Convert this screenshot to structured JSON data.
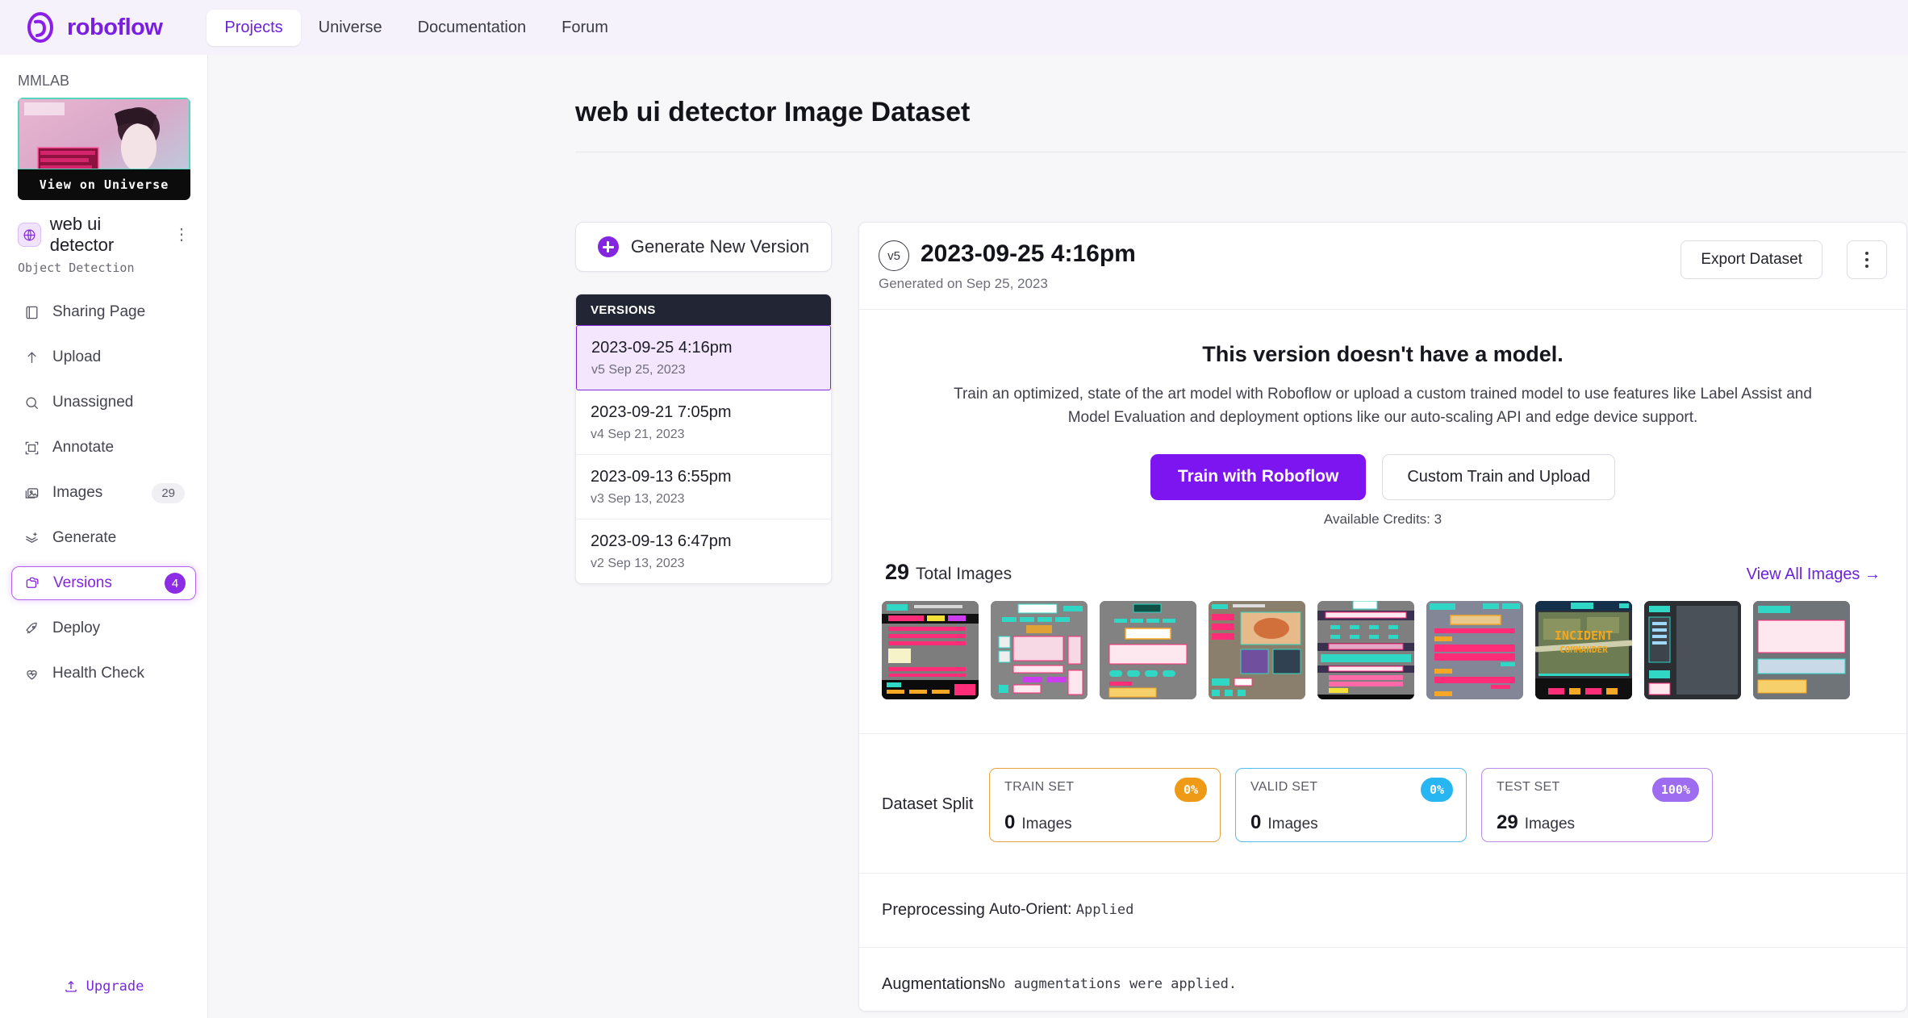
{
  "topnav": {
    "brand": "roboflow",
    "items": [
      {
        "label": "Projects",
        "active": true
      },
      {
        "label": "Universe",
        "active": false
      },
      {
        "label": "Documentation",
        "active": false
      },
      {
        "label": "Forum",
        "active": false
      }
    ]
  },
  "sidebar": {
    "workspace": "MMLAB",
    "thumbnail_overlay": "View on Universe",
    "project_name": "web ui detector",
    "project_type": "Object Detection",
    "items": [
      {
        "label": "Sharing Page",
        "icon": "book-icon",
        "badge": null,
        "selected": false
      },
      {
        "label": "Upload",
        "icon": "upload-arrow-icon",
        "badge": null,
        "selected": false
      },
      {
        "label": "Unassigned",
        "icon": "search-icon",
        "badge": null,
        "selected": false
      },
      {
        "label": "Annotate",
        "icon": "annotate-box-icon",
        "badge": null,
        "selected": false
      },
      {
        "label": "Images",
        "icon": "images-icon",
        "badge": "29",
        "selected": false
      },
      {
        "label": "Generate",
        "icon": "layers-plus-icon",
        "badge": null,
        "selected": false
      },
      {
        "label": "Versions",
        "icon": "folders-icon",
        "badge": "4",
        "selected": true
      },
      {
        "label": "Deploy",
        "icon": "rocket-icon",
        "badge": null,
        "selected": false
      },
      {
        "label": "Health Check",
        "icon": "heart-pulse-icon",
        "badge": null,
        "selected": false
      }
    ],
    "upgrade_label": "Upgrade"
  },
  "page": {
    "title": "web ui detector Image Dataset"
  },
  "left_column": {
    "generate_button": "Generate New Version",
    "versions_header": "VERSIONS",
    "versions": [
      {
        "name": "2023-09-25 4:16pm",
        "sub": "v5 Sep 25, 2023",
        "selected": true
      },
      {
        "name": "2023-09-21 7:05pm",
        "sub": "v4 Sep 21, 2023",
        "selected": false
      },
      {
        "name": "2023-09-13 6:55pm",
        "sub": "v3 Sep 13, 2023",
        "selected": false
      },
      {
        "name": "2023-09-13 6:47pm",
        "sub": "v2 Sep 13, 2023",
        "selected": false
      }
    ]
  },
  "version_card": {
    "version_badge": "v5",
    "title": "2023-09-25 4:16pm",
    "generated_on": "Generated on Sep 25, 2023",
    "export_label": "Export Dataset",
    "model": {
      "heading": "This version doesn't have a model.",
      "description": "Train an optimized, state of the art model with Roboflow or upload a custom trained model to use features like Label Assist and Model Evaluation and deployment options like our auto-scaling API and edge device support.",
      "primary_button": "Train with Roboflow",
      "secondary_button": "Custom Train and Upload",
      "credits": "Available Credits:  3"
    },
    "images": {
      "count": "29",
      "count_label": "Total Images",
      "view_all": "View All Images",
      "thumbnail_count": 9
    },
    "dataset_split": {
      "label": "Dataset Split",
      "cards": [
        {
          "title": "TRAIN SET",
          "pill": "0%",
          "count": "0",
          "unit": "Images",
          "color": "#ef9a16"
        },
        {
          "title": "VALID SET",
          "pill": "0%",
          "count": "0",
          "unit": "Images",
          "color": "#27b6f2"
        },
        {
          "title": "TEST SET",
          "pill": "100%",
          "count": "29",
          "unit": "Images",
          "color": "#9d6cf0"
        }
      ]
    },
    "preprocessing": {
      "label": "Preprocessing",
      "key": "Auto-Orient:",
      "value": "Applied"
    },
    "augmentations": {
      "label": "Augmentations",
      "value": "No augmentations were applied."
    }
  },
  "colors": {
    "brand_purple": "#7a1ee0",
    "primary_button": "#7c15f0",
    "selected_version_bg": "#f4e6fd",
    "versions_header_bg": "#222634"
  }
}
